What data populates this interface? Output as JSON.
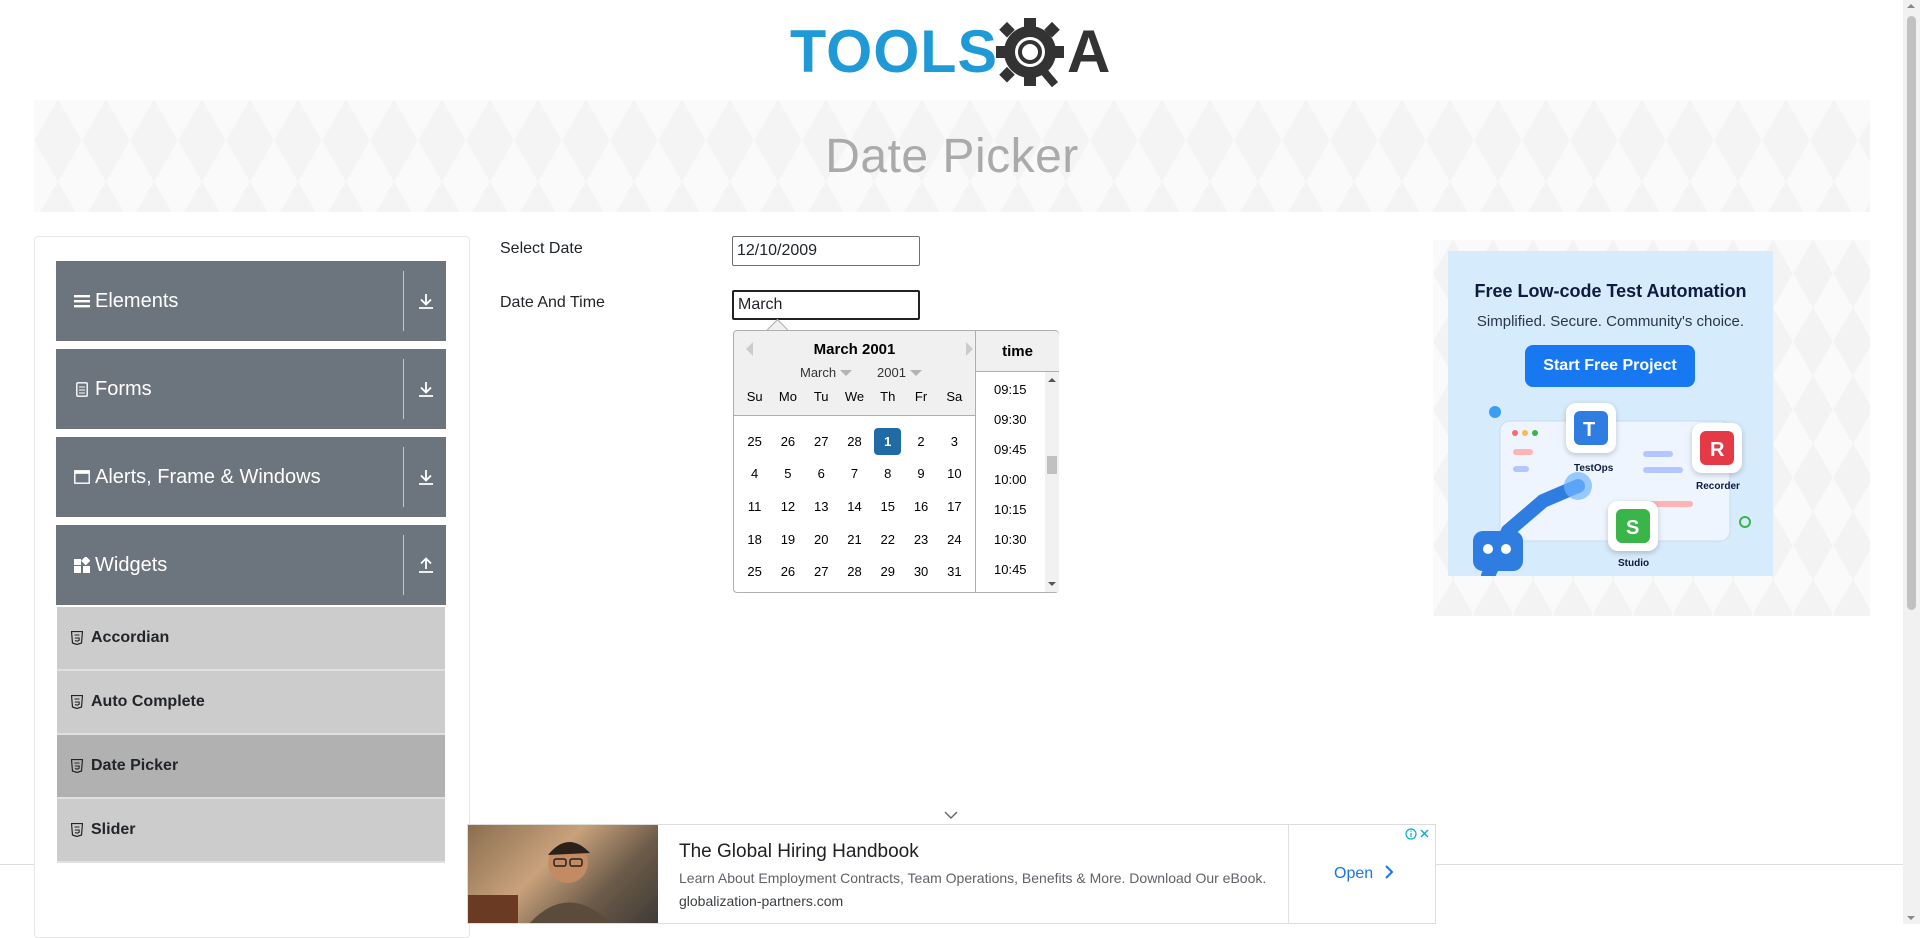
{
  "logo": {
    "text_left": "TOOLS",
    "text_right": "A"
  },
  "header": {
    "title": "Date Picker"
  },
  "sidebar": {
    "groups": [
      {
        "label": "Elements",
        "icon": "hamburger-icon",
        "expanded": false
      },
      {
        "label": "Forms",
        "icon": "document-icon",
        "expanded": false
      },
      {
        "label": "Alerts, Frame & Windows",
        "icon": "window-icon",
        "expanded": false
      },
      {
        "label": "Widgets",
        "icon": "widgets-icon",
        "expanded": true
      }
    ],
    "items": [
      {
        "label": "Accordian",
        "active": false
      },
      {
        "label": "Auto Complete",
        "active": false
      },
      {
        "label": "Date Picker",
        "active": true
      },
      {
        "label": "Slider",
        "active": false
      }
    ]
  },
  "form": {
    "select_date_label": "Select Date",
    "select_date_value": "12/10/2009",
    "date_time_label": "Date And Time",
    "date_time_value": "March"
  },
  "datepicker": {
    "month_year": "March 2001",
    "month_dropdown": "March",
    "year_dropdown": "2001",
    "weekdays": [
      "Su",
      "Mo",
      "Tu",
      "We",
      "Th",
      "Fr",
      "Sa"
    ],
    "weeks": [
      [
        "25",
        "26",
        "27",
        "28",
        "1",
        "2",
        "3"
      ],
      [
        "4",
        "5",
        "6",
        "7",
        "8",
        "9",
        "10"
      ],
      [
        "11",
        "12",
        "13",
        "14",
        "15",
        "16",
        "17"
      ],
      [
        "18",
        "19",
        "20",
        "21",
        "22",
        "23",
        "24"
      ],
      [
        "25",
        "26",
        "27",
        "28",
        "29",
        "30",
        "31"
      ]
    ],
    "selected_day": "1",
    "time_header": "time",
    "times": [
      "09:15",
      "09:30",
      "09:45",
      "10:00",
      "10:15",
      "10:30",
      "10:45"
    ]
  },
  "ad_right": {
    "title": "Free Low-code Test Automation",
    "subtitle": "Simplified. Secure. Community's choice.",
    "cta": "Start Free Project",
    "products": [
      "TestOps",
      "Recorder",
      "Studio"
    ],
    "brand_color": "#1778f2"
  },
  "ad_bottom": {
    "title": "The Global Hiring Handbook",
    "description": "Learn About Employment Contracts, Team Operations, Benefits & More. Download Our eBook.",
    "url": "globalization-partners.com",
    "cta": "Open"
  },
  "colors": {
    "sidebar_header": "#6c757d",
    "sidebar_item": "#cccccc",
    "sidebar_item_active": "#b1b1b1",
    "selected_day": "#216ba5",
    "logo_blue": "#1f9ad6",
    "logo_dark": "#333333"
  }
}
